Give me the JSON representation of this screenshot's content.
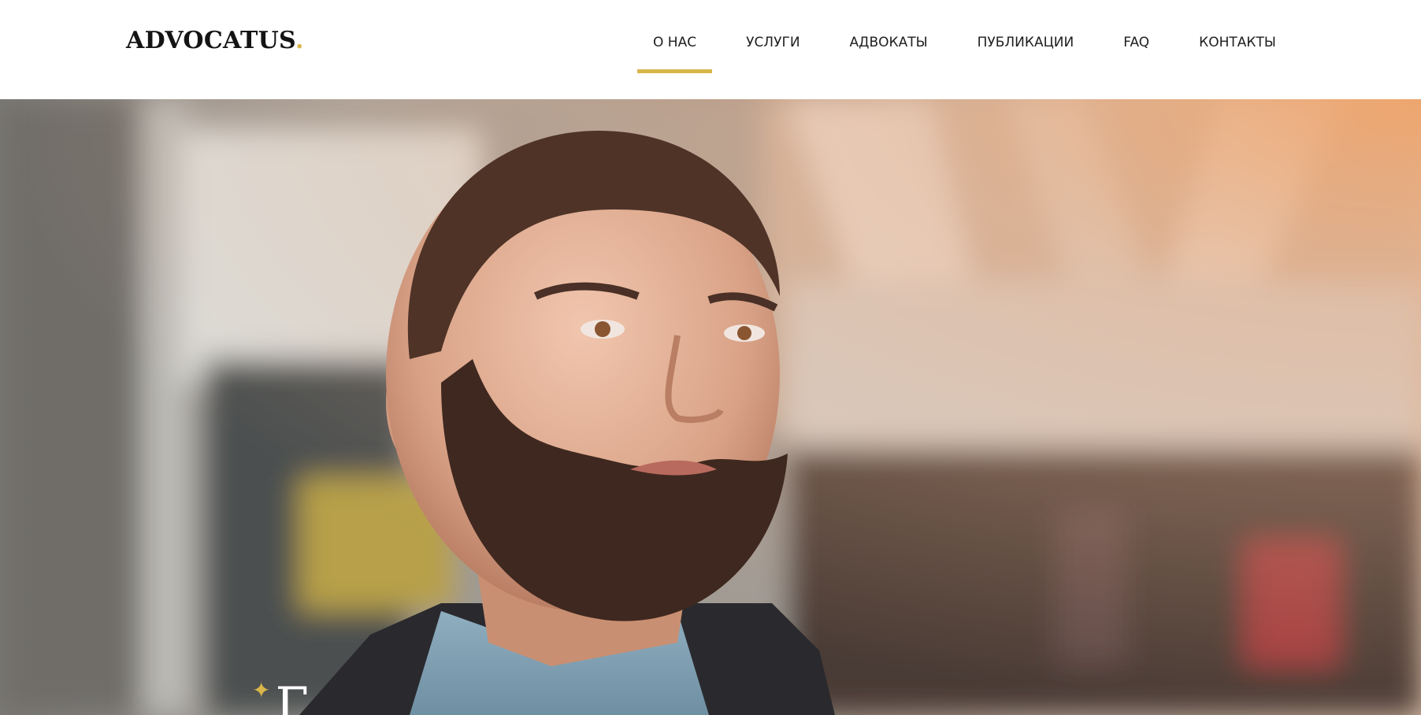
{
  "header": {
    "logo_text": "ADVOCATUS",
    "logo_dot": ".",
    "nav": [
      {
        "label": "О НАС",
        "active": true
      },
      {
        "label": "УСЛУГИ",
        "active": false
      },
      {
        "label": "АДВОКАТЫ",
        "active": false
      },
      {
        "label": "ПУБЛИКАЦИИ",
        "active": false
      },
      {
        "label": "FAQ",
        "active": false
      },
      {
        "label": "КОНТАКТЫ",
        "active": false
      }
    ]
  },
  "hero": {
    "image": "portrait-photo",
    "heading_partial": "Г"
  },
  "colors": {
    "accent": "#d8b64a",
    "text": "#1e1e1e",
    "background": "#ffffff"
  }
}
